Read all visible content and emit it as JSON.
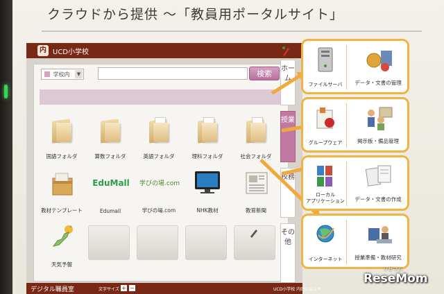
{
  "slide": {
    "title": "クラウドから提供 〜「教員用ポータルサイト」"
  },
  "portal": {
    "school_name": "UCD小学校",
    "logo_glyph": "内",
    "search": {
      "scope_label": "学校内",
      "button_label": "検索",
      "query": ""
    },
    "tiles": [
      {
        "label": "国語フォルダ",
        "icon": "folder-icon"
      },
      {
        "label": "算数フォルダ",
        "icon": "folder-icon"
      },
      {
        "label": "英語フォルダ",
        "icon": "folder-icon"
      },
      {
        "label": "理科フォルダ",
        "icon": "folder-icon"
      },
      {
        "label": "社会フォルダ",
        "icon": "folder-icon"
      },
      {
        "label": "教材テンプレート",
        "icon": "box-icon"
      },
      {
        "label": "Edumall",
        "logo_text": "EduMall",
        "icon": "edumall-logo"
      },
      {
        "label": "学びの場.com",
        "logo_text": "学びの場.com",
        "icon": "manabi-logo"
      },
      {
        "label": "NHK教材",
        "icon": "tv-icon"
      },
      {
        "label": "教育新聞",
        "icon": "newspaper-icon"
      },
      {
        "label": "天気予報",
        "icon": "japan-map-icon"
      }
    ],
    "side_tabs": [
      {
        "label": "ホーム",
        "active": false
      },
      {
        "label": "授業",
        "active": true
      },
      {
        "label": "校務",
        "active": false
      },
      {
        "label": "その他",
        "active": false
      }
    ],
    "status": {
      "app_name": "デジタル職員室",
      "font_size_label": "文字サイズ",
      "user": "UCD小学校 内田ヒロユキ"
    }
  },
  "services": [
    {
      "left": "ファイルサーバ",
      "right": "データ・文書の管理"
    },
    {
      "left": "グループウェア",
      "right": "掲示板・備品管理"
    },
    {
      "left": "ローカル\nアプリケーション",
      "right": "データ・文書の作成"
    },
    {
      "left": "インターネット",
      "right": "授業準備・教材研究"
    }
  ],
  "watermark": {
    "brand": "ReseMom",
    "sub": "リセマム"
  },
  "colors": {
    "appbar": "#7a2816",
    "accent_pink": "#c07aa2",
    "service_border": "#f2b341",
    "arrow": "#f0a93a"
  }
}
